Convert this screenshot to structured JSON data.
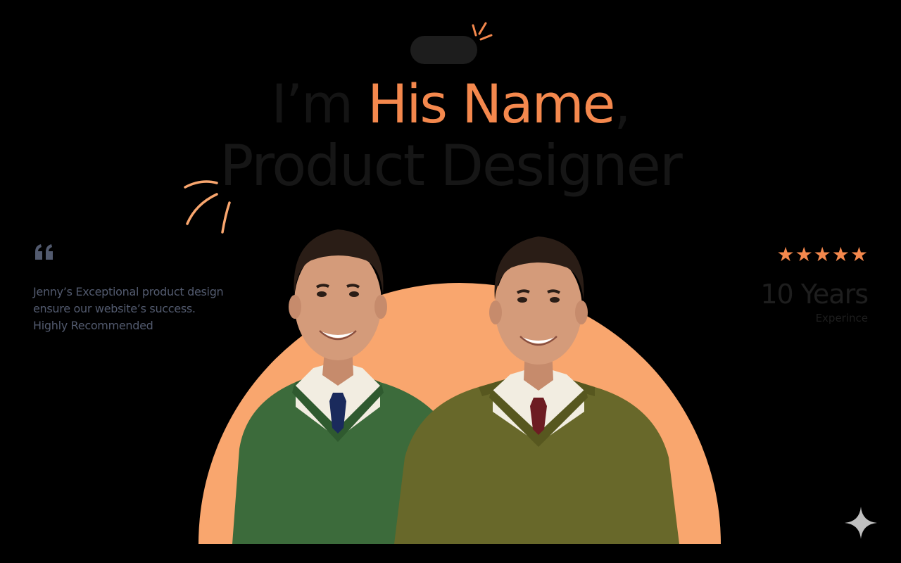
{
  "hero": {
    "greeting": "I’m ",
    "name": "His Name",
    "comma": ",",
    "role": "Product Designer"
  },
  "testimonial": {
    "quote_icon": "quote-icon",
    "text": "Jenny’s Exceptional product design\nensure our website’s success.\nHighly Recommended"
  },
  "experience": {
    "stars": [
      "★",
      "★",
      "★",
      "★",
      "★"
    ],
    "years": "10 Years",
    "label": "Experince"
  },
  "colors": {
    "background": "#000000",
    "accent": "#f4884d",
    "arch": "#f9a66e",
    "muted_text": "#525a6e"
  },
  "portraits": [
    {
      "name": "portrait-left",
      "sweater": "#3c6b3b",
      "tie": "#1a2a5c"
    },
    {
      "name": "portrait-right",
      "sweater": "#68682a",
      "tie": "#6d1c22"
    }
  ]
}
